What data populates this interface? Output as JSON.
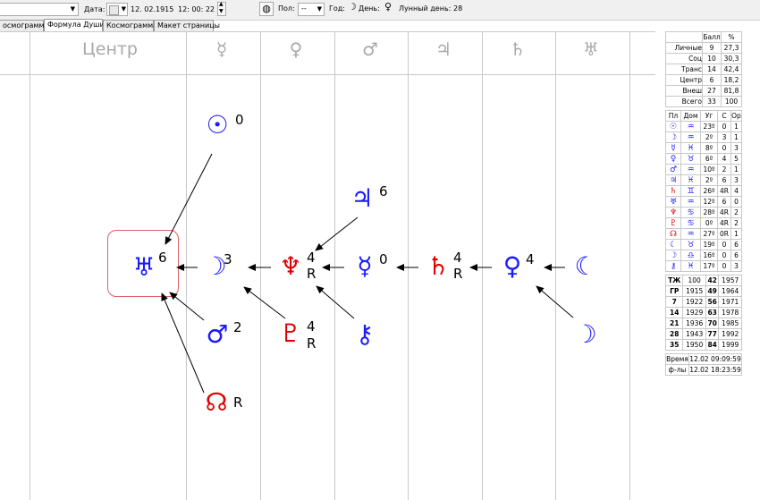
{
  "toolbar": {
    "date_label": "Дата:",
    "date_value": "12. 02.1915",
    "time_value": "12: 00: 22",
    "pol_label": "Пол:",
    "pol_value": "--",
    "god_label": "Год:",
    "den_label": "День:",
    "lunar_label": "Лунный день:",
    "lunar_value": "28"
  },
  "tabs": [
    "осмограмма",
    "Формула Души",
    "Космограмма",
    "Макет страницы"
  ],
  "active_tab": 1,
  "columns": [
    "Центр",
    "☿",
    "♀",
    "♂",
    "♃",
    "♄",
    "♅"
  ],
  "formula": {
    "sun": {
      "glyph": "☉",
      "num": "0"
    },
    "uranus": {
      "glyph": "♅",
      "num": "6"
    },
    "moon": {
      "glyph": "☽",
      "num": "3"
    },
    "neptune": {
      "glyph": "♆",
      "num": "4",
      "r": "R"
    },
    "mercury": {
      "glyph": "☿",
      "num": "0"
    },
    "saturn": {
      "glyph": "♄",
      "num": "4",
      "r": "R"
    },
    "venus": {
      "glyph": "♀",
      "num": "4"
    },
    "lilith": {
      "glyph": "☾"
    },
    "jupiter": {
      "glyph": "♃",
      "num": "6"
    },
    "mars": {
      "glyph": "♂",
      "num": "2"
    },
    "pluto": {
      "glyph": "♇",
      "num": "4",
      "r": "R"
    },
    "chiron": {
      "glyph": "⚷"
    },
    "node": {
      "glyph": "☊",
      "r": "R"
    },
    "selena": {
      "glyph": "☽"
    }
  },
  "colors": {
    "blue": "#1a1aff",
    "red": "#e00000",
    "box": "#e06060"
  },
  "stats": {
    "headers": [
      "",
      "Балл",
      "%"
    ],
    "rows": [
      [
        "Личные",
        "9",
        "27,3"
      ],
      [
        "Соц",
        "10",
        "30,3"
      ],
      [
        "Транс",
        "14",
        "42,4"
      ],
      [
        "Центр",
        "6",
        "18,2"
      ],
      [
        "Внеш",
        "27",
        "81,8"
      ],
      [
        "Всего",
        "33",
        "100"
      ]
    ]
  },
  "planets": {
    "headers": [
      "Пл",
      "Дом",
      "Уг",
      "С",
      "Ор"
    ],
    "rows": [
      {
        "p": "☉",
        "pc": "blue",
        "h": "♒",
        "deg": "23º",
        "s": "0",
        "o": "1"
      },
      {
        "p": "☽",
        "pc": "blue",
        "h": "♒",
        "deg": "2º",
        "s": "3",
        "o": "1"
      },
      {
        "p": "☿",
        "pc": "blue",
        "h": "♓",
        "deg": "8º",
        "s": "0",
        "o": "3"
      },
      {
        "p": "♀",
        "pc": "blue",
        "h": "♉",
        "deg": "6º",
        "s": "4",
        "o": "5"
      },
      {
        "p": "♂",
        "pc": "blue",
        "h": "♒",
        "deg": "10º",
        "s": "2",
        "o": "1"
      },
      {
        "p": "♃",
        "pc": "blue",
        "h": "♓",
        "deg": "2º",
        "s": "6",
        "o": "3"
      },
      {
        "p": "♄",
        "pc": "red",
        "h": "♊",
        "deg": "26º",
        "s": "4R",
        "o": "4"
      },
      {
        "p": "♅",
        "pc": "blue",
        "h": "♒",
        "deg": "12º",
        "s": "6",
        "o": "0"
      },
      {
        "p": "♆",
        "pc": "red",
        "h": "♋",
        "deg": "28º",
        "s": "4R",
        "o": "2"
      },
      {
        "p": "♇",
        "pc": "red",
        "h": "♋",
        "deg": "0º",
        "s": "4R",
        "o": "2"
      },
      {
        "p": "☊",
        "pc": "red",
        "h": "♒",
        "deg": "27º",
        "s": "0R",
        "o": "1"
      },
      {
        "p": "☾",
        "pc": "blue",
        "h": "♉",
        "deg": "19º",
        "s": "0",
        "o": "6"
      },
      {
        "p": "☽",
        "pc": "blue",
        "h": "♎",
        "deg": "16º",
        "s": "0",
        "o": "6"
      },
      {
        "p": "⚷",
        "pc": "blue",
        "h": "♓",
        "deg": "17º",
        "s": "0",
        "o": "3"
      }
    ]
  },
  "years": [
    [
      "ТЖ",
      "100",
      "42",
      "1957"
    ],
    [
      "ГР",
      "1915",
      "49",
      "1964"
    ],
    [
      "7",
      "1922",
      "56",
      "1971"
    ],
    [
      "14",
      "1929",
      "63",
      "1978"
    ],
    [
      "21",
      "1936",
      "70",
      "1985"
    ],
    [
      "28",
      "1943",
      "77",
      "1992"
    ],
    [
      "35",
      "1950",
      "84",
      "1999"
    ]
  ],
  "times": [
    [
      "Время",
      "12.02 09:09:59"
    ],
    [
      "ф-лы",
      "12.02 18:23:59"
    ]
  ]
}
